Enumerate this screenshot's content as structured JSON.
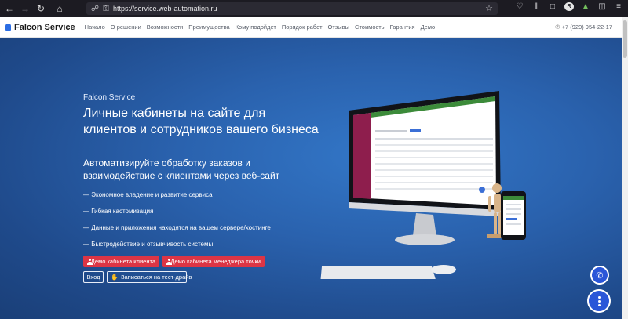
{
  "browser": {
    "url": "https://service.web-automation.ru"
  },
  "header": {
    "brand": "Falcon Service",
    "nav": [
      "Начало",
      "О решении",
      "Возможности",
      "Преимущества",
      "Кому подойдет",
      "Порядок работ",
      "Отзывы",
      "Стоимость",
      "Гарантия",
      "Демо"
    ],
    "phone": "+7 (920) 954-22-17"
  },
  "hero": {
    "subtitle": "Falcon Service",
    "title": "Личные кабинеты на сайте для клиентов и сотрудников вашего бизнеса",
    "lead": "Автоматизируйте обработку заказов и взаимодействие с клиентами через веб-сайт",
    "features": [
      "— Экономное владение и развитие сервиса",
      "— Гибкая кастомизация",
      "— Данные и приложения находятся на вашем сервере/хостинге",
      "— Быстродействие и отзывчивость системы"
    ],
    "btn_demo_client": "Демо кабинета клиента",
    "btn_demo_manager": "Демо кабинета менеджера точки",
    "btn_login": "Вход",
    "btn_testdrive": "Записаться на тест-драйв"
  },
  "colors": {
    "accent_red": "#dc3545",
    "brand_blue": "#2b6de3",
    "fab_blue": "#2a56d8"
  },
  "icons": {
    "fab_top": "phone-icon",
    "fab_bottom": "more-vertical-icon"
  }
}
